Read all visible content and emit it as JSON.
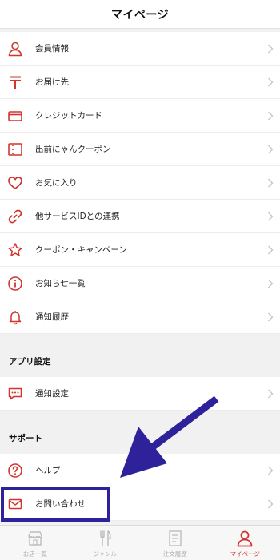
{
  "header": {
    "title": "マイページ"
  },
  "menu_items": [
    {
      "label": "会員情報",
      "icon": "person-icon"
    },
    {
      "label": "お届け先",
      "icon": "postal-mark-icon"
    },
    {
      "label": "クレジットカード",
      "icon": "credit-card-icon"
    },
    {
      "label": "出前にゃんクーポン",
      "icon": "coupon-ticket-icon"
    },
    {
      "label": "お気に入り",
      "icon": "heart-icon"
    },
    {
      "label": "他サービスIDとの連携",
      "icon": "link-icon"
    },
    {
      "label": "クーポン・キャンペーン",
      "icon": "star-icon"
    },
    {
      "label": "お知らせ一覧",
      "icon": "info-icon"
    },
    {
      "label": "通知履歴",
      "icon": "bell-icon"
    }
  ],
  "app_settings": {
    "title": "アプリ設定",
    "items": [
      {
        "label": "通知設定",
        "icon": "chat-bubble-icon"
      }
    ]
  },
  "support": {
    "title": "サポート",
    "items": [
      {
        "label": "ヘルプ",
        "icon": "question-icon"
      },
      {
        "label": "お問い合わせ",
        "icon": "envelope-icon"
      }
    ]
  },
  "tabbar": {
    "tabs": [
      {
        "label": "お店一覧",
        "icon": "shop-icon",
        "active": false
      },
      {
        "label": "ジャンル",
        "icon": "fork-knife-icon",
        "active": false
      },
      {
        "label": "注文履歴",
        "icon": "receipt-icon",
        "active": false
      },
      {
        "label": "マイページ",
        "icon": "person-icon",
        "active": true
      }
    ]
  },
  "colors": {
    "accent": "#d0352f",
    "annotation": "#2e229b",
    "inactive_tab": "#b0b0b0"
  }
}
